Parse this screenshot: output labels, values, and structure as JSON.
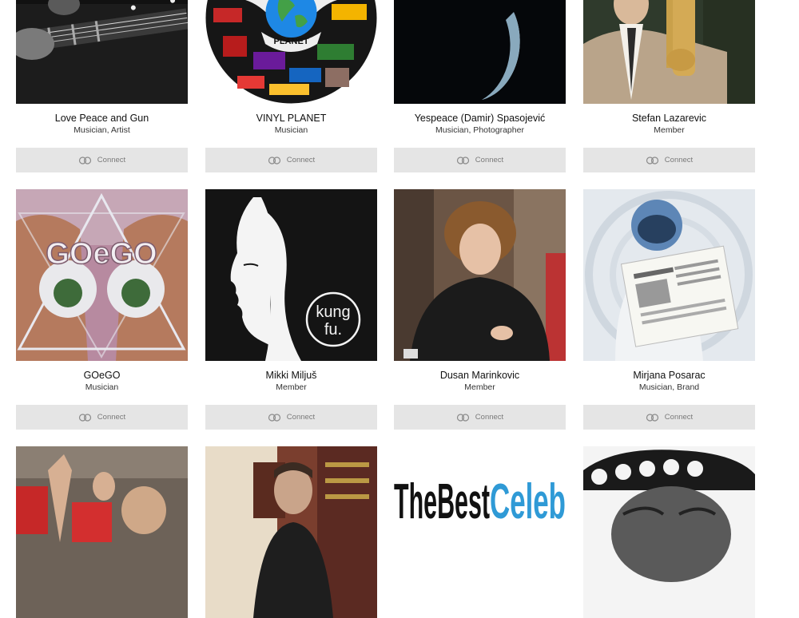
{
  "connect_label": "Connect",
  "profiles": [
    {
      "name": "Love Peace and Gun",
      "role": "Musician, Artist"
    },
    {
      "name": "VINYL PLANET",
      "role": "Musician"
    },
    {
      "name": "Yespeace (Damir) Spasojević",
      "role": "Musician, Photographer"
    },
    {
      "name": "Stefan Lazarevic",
      "role": "Member"
    },
    {
      "name": "GOeGO",
      "role": "Musician"
    },
    {
      "name": "Mikki Miljuš",
      "role": "Member"
    },
    {
      "name": "Dusan Marinkovic",
      "role": "Member"
    },
    {
      "name": "Mirjana Posarac",
      "role": "Musician, Brand"
    }
  ],
  "image_text": {
    "goego_logo": "GOeGO",
    "kungfu_logo_line1": "kung",
    "kungfu_logo_line2": "fu.",
    "vinyl_planet_logo": "PLANET",
    "bestceleb_part1": "TheBest",
    "bestceleb_part2": "Celeb"
  },
  "colors": {
    "button_bg": "#e5e5e5",
    "button_text": "#7a7a7a"
  }
}
